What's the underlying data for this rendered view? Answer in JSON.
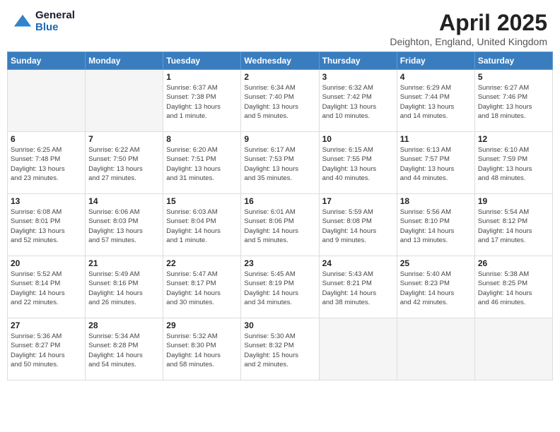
{
  "header": {
    "logo_general": "General",
    "logo_blue": "Blue",
    "title": "April 2025",
    "location": "Deighton, England, United Kingdom"
  },
  "days_of_week": [
    "Sunday",
    "Monday",
    "Tuesday",
    "Wednesday",
    "Thursday",
    "Friday",
    "Saturday"
  ],
  "weeks": [
    [
      {
        "day": "",
        "info": ""
      },
      {
        "day": "",
        "info": ""
      },
      {
        "day": "1",
        "info": "Sunrise: 6:37 AM\nSunset: 7:38 PM\nDaylight: 13 hours\nand 1 minute."
      },
      {
        "day": "2",
        "info": "Sunrise: 6:34 AM\nSunset: 7:40 PM\nDaylight: 13 hours\nand 5 minutes."
      },
      {
        "day": "3",
        "info": "Sunrise: 6:32 AM\nSunset: 7:42 PM\nDaylight: 13 hours\nand 10 minutes."
      },
      {
        "day": "4",
        "info": "Sunrise: 6:29 AM\nSunset: 7:44 PM\nDaylight: 13 hours\nand 14 minutes."
      },
      {
        "day": "5",
        "info": "Sunrise: 6:27 AM\nSunset: 7:46 PM\nDaylight: 13 hours\nand 18 minutes."
      }
    ],
    [
      {
        "day": "6",
        "info": "Sunrise: 6:25 AM\nSunset: 7:48 PM\nDaylight: 13 hours\nand 23 minutes."
      },
      {
        "day": "7",
        "info": "Sunrise: 6:22 AM\nSunset: 7:50 PM\nDaylight: 13 hours\nand 27 minutes."
      },
      {
        "day": "8",
        "info": "Sunrise: 6:20 AM\nSunset: 7:51 PM\nDaylight: 13 hours\nand 31 minutes."
      },
      {
        "day": "9",
        "info": "Sunrise: 6:17 AM\nSunset: 7:53 PM\nDaylight: 13 hours\nand 35 minutes."
      },
      {
        "day": "10",
        "info": "Sunrise: 6:15 AM\nSunset: 7:55 PM\nDaylight: 13 hours\nand 40 minutes."
      },
      {
        "day": "11",
        "info": "Sunrise: 6:13 AM\nSunset: 7:57 PM\nDaylight: 13 hours\nand 44 minutes."
      },
      {
        "day": "12",
        "info": "Sunrise: 6:10 AM\nSunset: 7:59 PM\nDaylight: 13 hours\nand 48 minutes."
      }
    ],
    [
      {
        "day": "13",
        "info": "Sunrise: 6:08 AM\nSunset: 8:01 PM\nDaylight: 13 hours\nand 52 minutes."
      },
      {
        "day": "14",
        "info": "Sunrise: 6:06 AM\nSunset: 8:03 PM\nDaylight: 13 hours\nand 57 minutes."
      },
      {
        "day": "15",
        "info": "Sunrise: 6:03 AM\nSunset: 8:04 PM\nDaylight: 14 hours\nand 1 minute."
      },
      {
        "day": "16",
        "info": "Sunrise: 6:01 AM\nSunset: 8:06 PM\nDaylight: 14 hours\nand 5 minutes."
      },
      {
        "day": "17",
        "info": "Sunrise: 5:59 AM\nSunset: 8:08 PM\nDaylight: 14 hours\nand 9 minutes."
      },
      {
        "day": "18",
        "info": "Sunrise: 5:56 AM\nSunset: 8:10 PM\nDaylight: 14 hours\nand 13 minutes."
      },
      {
        "day": "19",
        "info": "Sunrise: 5:54 AM\nSunset: 8:12 PM\nDaylight: 14 hours\nand 17 minutes."
      }
    ],
    [
      {
        "day": "20",
        "info": "Sunrise: 5:52 AM\nSunset: 8:14 PM\nDaylight: 14 hours\nand 22 minutes."
      },
      {
        "day": "21",
        "info": "Sunrise: 5:49 AM\nSunset: 8:16 PM\nDaylight: 14 hours\nand 26 minutes."
      },
      {
        "day": "22",
        "info": "Sunrise: 5:47 AM\nSunset: 8:17 PM\nDaylight: 14 hours\nand 30 minutes."
      },
      {
        "day": "23",
        "info": "Sunrise: 5:45 AM\nSunset: 8:19 PM\nDaylight: 14 hours\nand 34 minutes."
      },
      {
        "day": "24",
        "info": "Sunrise: 5:43 AM\nSunset: 8:21 PM\nDaylight: 14 hours\nand 38 minutes."
      },
      {
        "day": "25",
        "info": "Sunrise: 5:40 AM\nSunset: 8:23 PM\nDaylight: 14 hours\nand 42 minutes."
      },
      {
        "day": "26",
        "info": "Sunrise: 5:38 AM\nSunset: 8:25 PM\nDaylight: 14 hours\nand 46 minutes."
      }
    ],
    [
      {
        "day": "27",
        "info": "Sunrise: 5:36 AM\nSunset: 8:27 PM\nDaylight: 14 hours\nand 50 minutes."
      },
      {
        "day": "28",
        "info": "Sunrise: 5:34 AM\nSunset: 8:28 PM\nDaylight: 14 hours\nand 54 minutes."
      },
      {
        "day": "29",
        "info": "Sunrise: 5:32 AM\nSunset: 8:30 PM\nDaylight: 14 hours\nand 58 minutes."
      },
      {
        "day": "30",
        "info": "Sunrise: 5:30 AM\nSunset: 8:32 PM\nDaylight: 15 hours\nand 2 minutes."
      },
      {
        "day": "",
        "info": ""
      },
      {
        "day": "",
        "info": ""
      },
      {
        "day": "",
        "info": ""
      }
    ]
  ]
}
